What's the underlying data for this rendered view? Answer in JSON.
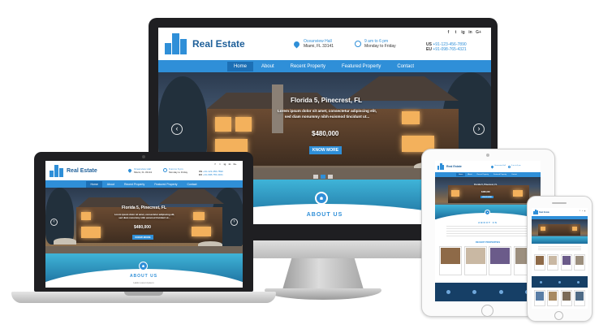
{
  "brand": {
    "name": "Real Estate",
    "accent": "#2f8fd8",
    "nav_bg": "#2f8fd8",
    "dark": "#1f1f22"
  },
  "header": {
    "address_line1": "Oceanview Hall",
    "address_line2": "Miami, FL 33141",
    "hours_line1": "9 am to 6 pm",
    "hours_line2": "Monday to Friday",
    "phone_us_label": "US",
    "phone_us": "+91-123-456-7890",
    "phone_eu_label": "EU",
    "phone_eu": "+91-098-765-4321",
    "social": [
      "f",
      "t",
      "ig",
      "in",
      "G+"
    ]
  },
  "nav": [
    "Home",
    "About",
    "Recent Property",
    "Featured Property",
    "Contact"
  ],
  "hero": {
    "title": "Florida 5, Pinecrest, FL",
    "desc_line1": "Lorem ipsum dolor sit amet, consectetur adipiscing elit,",
    "desc_line2": "sed diam nonummy nibh euismod tincidunt ut...",
    "price": "$480,000",
    "button": "KNOW MORE",
    "prev_icon": "chevron-left-icon",
    "next_icon": "chevron-right-icon"
  },
  "about": {
    "title": "ABOUT US",
    "subtitle": "Hello Lorem Ipsum"
  },
  "recent": {
    "title": "RECENT PROPERTIES"
  }
}
